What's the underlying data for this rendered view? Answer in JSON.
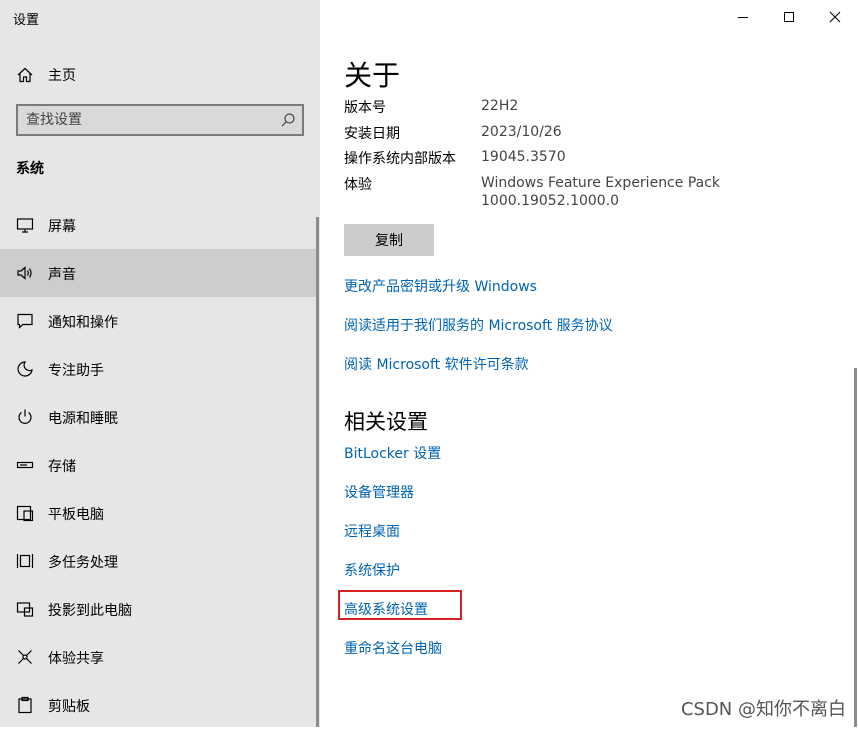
{
  "app": {
    "title": "设置"
  },
  "sidebar": {
    "home_label": "主页",
    "search_placeholder": "查找设置",
    "section": "系统",
    "items": [
      {
        "label": "屏幕",
        "icon": "monitor-icon"
      },
      {
        "label": "声音",
        "icon": "speaker-icon",
        "selected": true
      },
      {
        "label": "通知和操作",
        "icon": "message-icon"
      },
      {
        "label": "专注助手",
        "icon": "moon-icon"
      },
      {
        "label": "电源和睡眠",
        "icon": "power-icon"
      },
      {
        "label": "存储",
        "icon": "storage-icon"
      },
      {
        "label": "平板电脑",
        "icon": "tablet-icon"
      },
      {
        "label": "多任务处理",
        "icon": "multitask-icon"
      },
      {
        "label": "投影到此电脑",
        "icon": "project-icon"
      },
      {
        "label": "体验共享",
        "icon": "share-icon"
      },
      {
        "label": "剪贴板",
        "icon": "clipboard-icon"
      }
    ]
  },
  "about": {
    "title": "关于",
    "rows": [
      {
        "key": "版本号",
        "value": "22H2"
      },
      {
        "key": "安装日期",
        "value": "2023/10/26"
      },
      {
        "key": "操作系统内部版本",
        "value": "19045.3570"
      },
      {
        "key": "体验",
        "value": "Windows Feature Experience Pack",
        "value2": "1000.19052.1000.0"
      }
    ],
    "copy_button": "复制",
    "links": [
      "更改产品密钥或升级 Windows",
      "阅读适用于我们服务的 Microsoft 服务协议",
      "阅读 Microsoft 软件许可条款"
    ]
  },
  "related": {
    "title": "相关设置",
    "links": [
      "BitLocker 设置",
      "设备管理器",
      "远程桌面",
      "系统保护",
      "高级系统设置",
      "重命名这台电脑"
    ]
  },
  "watermark": "CSDN @知你不离白",
  "colors": {
    "accent": "#0063b1",
    "highlight": "#d92020",
    "sidebar_bg": "#e6e6e6"
  }
}
